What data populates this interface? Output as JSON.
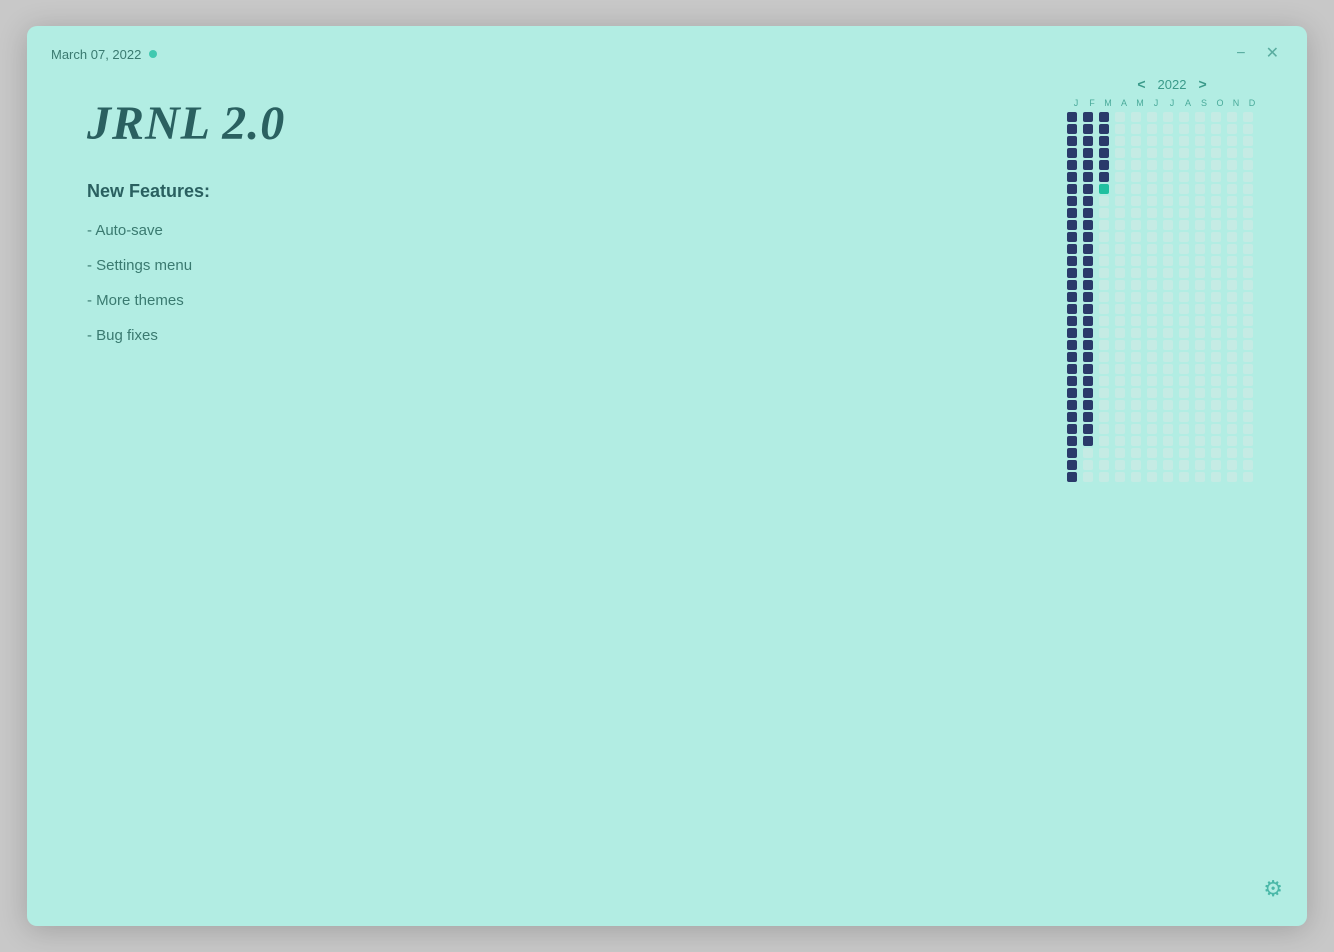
{
  "titleBar": {
    "date": "March 07, 2022",
    "minimizeLabel": "−",
    "closeLabel": "✕"
  },
  "main": {
    "appTitle": "JRNL 2.0",
    "featuresHeading": "New Features:",
    "features": [
      "- Auto-save",
      "- Settings menu",
      "- More themes",
      "- Bug fixes"
    ]
  },
  "calendar": {
    "year": "2022",
    "months": [
      "J",
      "F",
      "M",
      "A",
      "M",
      "J",
      "J",
      "A",
      "S",
      "O",
      "N",
      "D"
    ],
    "prevLabel": "<",
    "nextLabel": ">"
  },
  "settingsIconLabel": "⚙"
}
